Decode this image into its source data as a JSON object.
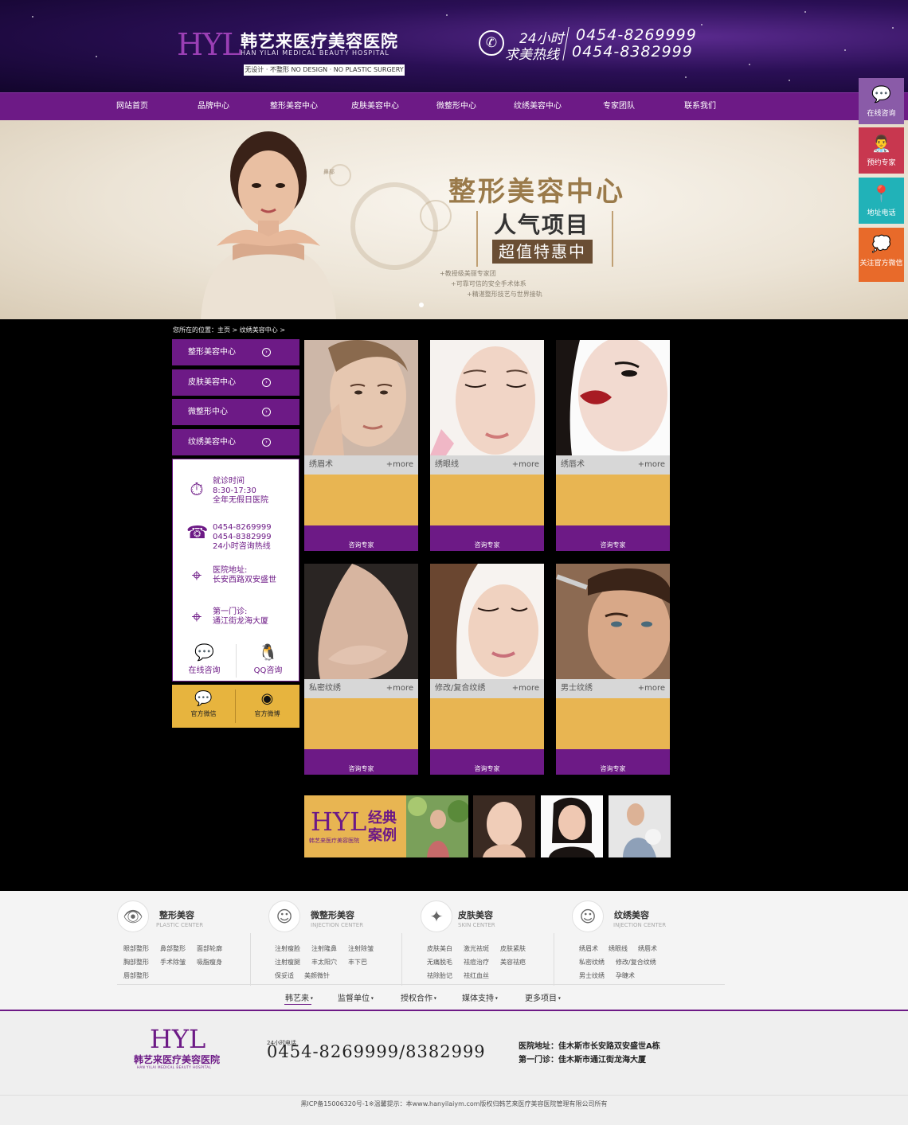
{
  "header": {
    "logo_mark": "HYL",
    "name_cn": "韩艺来医疗美容医院",
    "name_en": "HAN YILAI MEDICAL BEAUTY HOSPITAL",
    "slogan": "无设计 · 不整形  NO DESIGN · NO PLASTIC SURGERY",
    "hours_label": "24小时",
    "hotline_label": "求美热线",
    "phone_1": "0454-8269999",
    "phone_2": "0454-8382999",
    "phone_icon": "phone-icon"
  },
  "nav": {
    "items": [
      "网站首页",
      "品牌中心",
      "整形美容中心",
      "皮肤美容中心",
      "微整形中心",
      "纹绣美容中心",
      "专家团队",
      "联系我们"
    ]
  },
  "float_bar": {
    "items": [
      {
        "label": "在线咨询",
        "icon": "chat-icon",
        "color": "#8a5ba8"
      },
      {
        "label": "预约专家",
        "icon": "doctor-icon",
        "color": "#c8374f"
      },
      {
        "label": "地址电话",
        "icon": "location-icon",
        "color": "#21b2b8"
      },
      {
        "label": "关注官方微信",
        "icon": "wechat-icon",
        "color": "#e86a2a"
      }
    ]
  },
  "banner": {
    "title": "整形美容中心",
    "subtitle": "人气项目",
    "promo": "超值特惠中",
    "tag": "鼻部",
    "bullets": [
      "+教授级美丽专家团",
      "+可靠可信的安全手术体系",
      "+精湛整形技艺与世界接轨"
    ]
  },
  "breadcrumb": "您所在的位置：主页 > 纹绣美容中心 >",
  "side_menu": {
    "items": [
      "整形美容中心",
      "皮肤美容中心",
      "微整形中心",
      "纹绣美容中心"
    ],
    "arrow": "›"
  },
  "info_box": {
    "hours": [
      "就诊时间",
      "8:30-17:30",
      "全年无假日医院"
    ],
    "phones": [
      "0454-8269999",
      "0454-8382999",
      "24小时咨询热线"
    ],
    "address": [
      "医院地址:",
      "长安西路双安盛世"
    ],
    "branch": [
      "第一门诊:",
      "通江街龙海大厦"
    ],
    "online_consult": "在线咨询",
    "qq_consult": "QQ咨询"
  },
  "social": {
    "wechat": "官方微信",
    "weibo": "官方微博"
  },
  "cards": {
    "more": "+more",
    "ask": "咨询专家",
    "items": [
      {
        "name": "绣眉术"
      },
      {
        "name": "绣眼线"
      },
      {
        "name": "绣唇术"
      },
      {
        "name": "私密纹绣"
      },
      {
        "name": "修改/复合纹绣"
      },
      {
        "name": "男士纹绣"
      }
    ]
  },
  "cases": {
    "logo": "HYL",
    "cn": "韩艺来医疗美容医院",
    "title_1": "经典",
    "title_2": "案例"
  },
  "footer_categories": [
    {
      "title": "整形美容",
      "en": "PLASTIC CENTER",
      "icon": "eye-icon",
      "links": [
        "眼部整形",
        "鼻部整形",
        "面部轮廓",
        "胸部整形",
        "手术除皱",
        "吸脂瘦身",
        "唇部整形"
      ]
    },
    {
      "title": "微整形美容",
      "en": "INJECTION CENTER",
      "icon": "face-icon",
      "links": [
        "注射瘦脸",
        "注射隆鼻",
        "注射除皱",
        "注射瘦腿",
        "丰太阳穴",
        "丰下巴",
        "保妥适",
        "美颜微针"
      ]
    },
    {
      "title": "皮肤美容",
      "en": "SKIN CENTER",
      "icon": "sparkle-icon",
      "links": [
        "皮肤美白",
        "激光祛斑",
        "皮肤紧肤",
        "无痛脱毛",
        "祛痘治疗",
        "美容祛疤",
        "祛除胎记",
        "祛红血丝"
      ]
    },
    {
      "title": "纹绣美容",
      "en": "INJECTION CENTER",
      "icon": "face-outline-icon",
      "links": [
        "绣眉术",
        "绣眼线",
        "绣唇术",
        "私密纹绣",
        "修改/复合纹绣",
        "男士纹绣",
        "孕睫术"
      ]
    }
  ],
  "footer_nav": [
    "韩艺来",
    "监督单位",
    "授权合作",
    "媒体支持",
    "更多项目"
  ],
  "footer": {
    "logo": "HYL",
    "name": "韩艺来医疗美容医院",
    "en": "HAN YILAI MEDICAL BEAUTY HOSPITAL",
    "tel_label": "24小时电话",
    "tel": "0454-8269999/8382999",
    "addr_1": "医院地址：佳木斯市长安路双安盛世A栋",
    "addr_2": "第一门诊：佳木斯市通江街龙海大厦",
    "copyright": "黑ICP备15006320号-1※温馨提示：本www.hanyilaiym.com版权归韩艺来医疗美容医院管理有限公司所有"
  }
}
